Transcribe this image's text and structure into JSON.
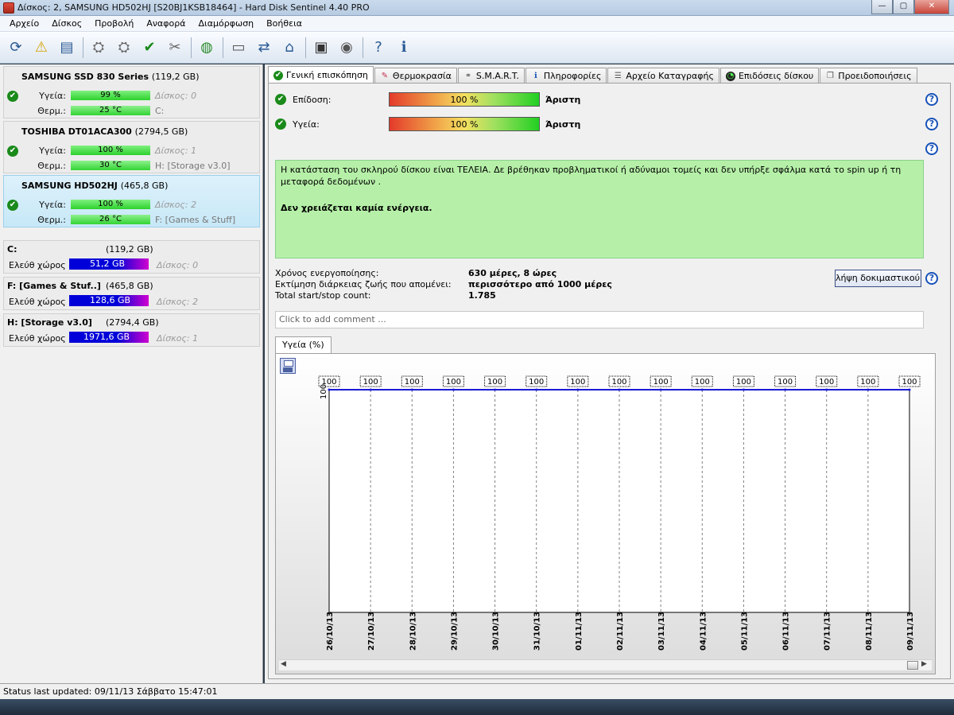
{
  "window": {
    "title": "Δίσκος: 2, SAMSUNG HD502HJ [S20BJ1KSB18464]  -  Hard Disk Sentinel 4.40 PRO",
    "minimize": "—",
    "maximize": "▢",
    "close": "✕"
  },
  "menu": [
    "Αρχείο",
    "Δίσκος",
    "Προβολή",
    "Αναφορά",
    "Διαμόρφωση",
    "Βοήθεια"
  ],
  "disks": [
    {
      "name": "SAMSUNG SSD 830 Series",
      "size": "(119,2 GB)",
      "health_label": "Υγεία:",
      "health": "99 %",
      "health_fraction": 0.99,
      "disk_ref": "Δίσκος: 0",
      "temp_label": "Θερμ.:",
      "temp": "25 °C",
      "volume": "C:"
    },
    {
      "name": "TOSHIBA DT01ACA300",
      "size": "(2794,5 GB)",
      "health_label": "Υγεία:",
      "health": "100 %",
      "health_fraction": 1.0,
      "disk_ref": "Δίσκος: 1",
      "temp_label": "Θερμ.:",
      "temp": "30 °C",
      "volume": "H: [Storage v3.0]"
    },
    {
      "name": "SAMSUNG HD502HJ",
      "size": "(465,8 GB)",
      "health_label": "Υγεία:",
      "health": "100 %",
      "health_fraction": 1.0,
      "disk_ref": "Δίσκος: 2",
      "temp_label": "Θερμ.:",
      "temp": "26 °C",
      "volume": "F: [Games & Stuff]"
    }
  ],
  "volumes": [
    {
      "name": "C:",
      "size": "(119,2 GB)",
      "free_label": "Ελεύθ χώρος",
      "free": "51,2 GB",
      "disk_ref": "Δίσκος: 0"
    },
    {
      "name": "F: [Games & Stuf..]",
      "size": "(465,8 GB)",
      "free_label": "Ελεύθ χώρος",
      "free": "128,6 GB",
      "disk_ref": "Δίσκος: 2"
    },
    {
      "name": "H: [Storage v3.0]",
      "size": "(2794,4 GB)",
      "free_label": "Ελεύθ χώρος",
      "free": "1971,6 GB",
      "disk_ref": "Δίσκος: 1"
    }
  ],
  "tabs": [
    "Γενική επισκόπηση",
    "Θερμοκρασία",
    "S.M.A.R.T.",
    "Πληροφορίες",
    "Αρχείο Καταγραφής",
    "Επιδόσεις δίσκου",
    "Προειδοποιήσεις"
  ],
  "overview": {
    "performance_label": "Επίδοση:",
    "performance_value": "100 %",
    "performance_word": "Άριστη",
    "health_label": "Υγεία:",
    "health_value": "100 %",
    "health_word": "Άριστη",
    "status_text": "Η κατάσταση του σκληρού δίσκου είναι ΤΕΛΕΙΑ. Δε βρέθηκαν προβληματικοί ή αδύναμοι τομείς και δεν υπήρξε σφάλμα κατά το spin up ή τη μεταφορά δεδομένων .",
    "action_text": "Δεν χρειάζεται καμία ενέργεια.",
    "power_on_label": "Χρόνος ενεργοποίησης:",
    "power_on_value": "630 μέρες, 8 ώρες",
    "lifetime_label": "Εκτίμηση διάρκειας ζωής που απομένει:",
    "lifetime_value": "περισσότερο από 1000 μέρες",
    "startstop_label": "Total start/stop count:",
    "startstop_value": "1.785",
    "test_button": "λήψη δοκιμαστικού",
    "comment_placeholder": "Click to add comment ..."
  },
  "chart_tab": "Υγεία (%)",
  "chart_data": {
    "type": "line",
    "x": [
      "26/10/13",
      "27/10/13",
      "28/10/13",
      "29/10/13",
      "30/10/13",
      "31/10/13",
      "01/11/13",
      "02/11/13",
      "03/11/13",
      "04/11/13",
      "05/11/13",
      "06/11/13",
      "07/11/13",
      "08/11/13",
      "09/11/13"
    ],
    "series": [
      {
        "values": [
          100,
          100,
          100,
          100,
          100,
          100,
          100,
          100,
          100,
          100,
          100,
          100,
          100,
          100,
          100
        ]
      }
    ],
    "ytick": "100",
    "ylim": [
      0,
      100
    ],
    "line_color": "#1a1ad8",
    "grid": true
  },
  "status_bar": "Status last updated: 09/11/13 Σάββατο 15:47:01"
}
